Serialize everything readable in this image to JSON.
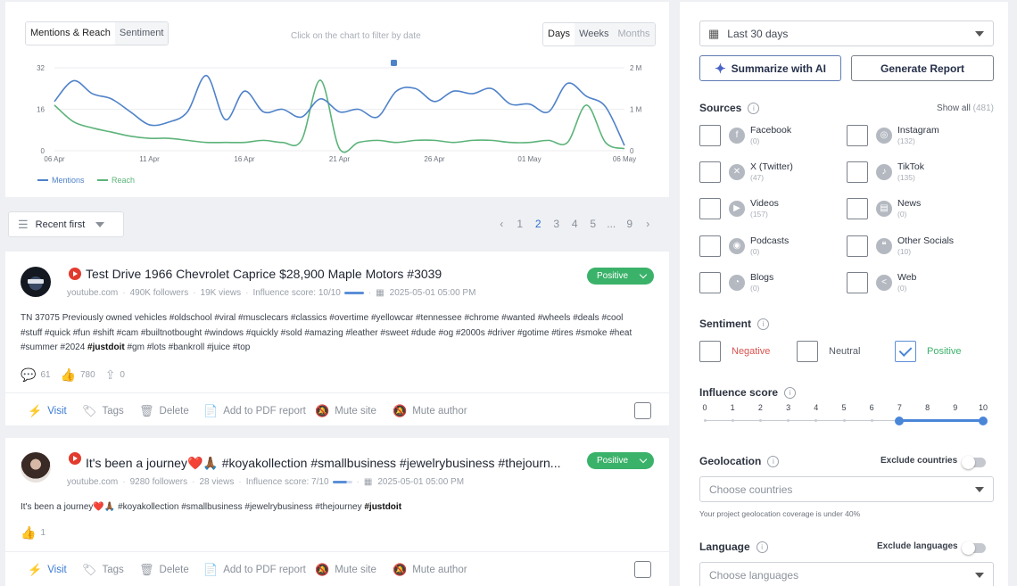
{
  "chart": {
    "tabs": [
      "Mentions & Reach",
      "Sentiment"
    ],
    "hint": "Click on the chart to filter by date",
    "range_tabs": [
      "Days",
      "Weeks",
      "Months"
    ],
    "y_left_ticks": [
      "32",
      "16",
      "0"
    ],
    "y_right_ticks": [
      "2 M",
      "1 M",
      "0"
    ],
    "x_ticks": [
      "06 Apr",
      "11 Apr",
      "16 Apr",
      "21 Apr",
      "26 Apr",
      "01 May",
      "06 May"
    ],
    "legend": [
      "Mentions",
      "Reach"
    ],
    "colors": {
      "mentions": "#4f82c9",
      "reach": "#5cb37a"
    }
  },
  "chart_data": {
    "type": "line",
    "x": [
      "06 Apr",
      "07 Apr",
      "08 Apr",
      "09 Apr",
      "10 Apr",
      "11 Apr",
      "12 Apr",
      "13 Apr",
      "14 Apr",
      "15 Apr",
      "16 Apr",
      "17 Apr",
      "18 Apr",
      "19 Apr",
      "20 Apr",
      "21 Apr",
      "22 Apr",
      "23 Apr",
      "24 Apr",
      "25 Apr",
      "26 Apr",
      "27 Apr",
      "28 Apr",
      "29 Apr",
      "30 Apr",
      "01 May",
      "02 May",
      "03 May",
      "04 May",
      "05 May",
      "06 May"
    ],
    "series": [
      {
        "name": "Mentions",
        "axis": "left",
        "values": [
          19,
          27,
          22,
          20,
          15,
          10,
          11,
          15,
          29,
          12,
          23,
          15,
          16,
          13,
          20,
          15,
          16,
          13,
          23,
          24,
          19,
          23,
          22,
          24,
          18,
          18,
          15,
          26,
          21,
          17,
          2
        ]
      },
      {
        "name": "Reach",
        "axis": "right",
        "values": [
          1.1,
          0.7,
          0.55,
          0.45,
          0.35,
          0.3,
          0.3,
          0.25,
          0.2,
          0.2,
          0.2,
          0.25,
          0.2,
          0.25,
          1.7,
          0.05,
          0.2,
          0.25,
          0.2,
          0.25,
          0.25,
          0.2,
          0.25,
          0.25,
          0.2,
          0.2,
          0.25,
          0.2,
          1.1,
          0.2,
          0.05
        ]
      }
    ],
    "ylim_left": [
      0,
      32
    ],
    "ylim_right": [
      0,
      2
    ],
    "legend_position": "bottom-left"
  },
  "sort": {
    "label": "Recent first"
  },
  "pagination": {
    "pages": [
      "1",
      "2",
      "3",
      "4",
      "5",
      "...",
      "9"
    ],
    "current": "2"
  },
  "posts": [
    {
      "title": "Test Drive 1966 Chevrolet Caprice $28,900 Maple Motors #3039",
      "source": "youtube.com",
      "followers": "490K followers",
      "views": "19K views",
      "influence": "Influence score: 10/10",
      "date": "2025-05-01 05:00 PM",
      "sentiment": "Positive",
      "text": "TN 37075 Previously owned vehicles #oldschool #viral #musclecars #classics #overtime #yellowcar #tennessee #chrome #wanted #wheels #deals #cool #stuff #quick #fun #shift #cam #builtnotbought #windows #quickly #sold #amazing #leather #sweet #dude #og #2000s #driver #gotime #tires #smoke #heat #summer #2024",
      "text_bold": "#justdoit",
      "text_after": "#gm #lots #bankroll #juice #top",
      "comments": "61",
      "likes": "780",
      "shares": "0"
    },
    {
      "title": "It's been a journey❤️🙏🏾 #koyakollection #smallbusiness #jewelrybusiness #thejourn...",
      "source": "youtube.com",
      "followers": "9280 followers",
      "views": "28 views",
      "influence": "Influence score: 7/10",
      "date": "2025-05-01 05:00 PM",
      "sentiment": "Positive",
      "text": "It's been a journey❤️🙏🏾 #koyakollection #smallbusiness #jewelrybusiness #thejourney",
      "text_bold": "#justdoit",
      "likes": "1"
    }
  ],
  "actions": [
    "Visit",
    "Tags",
    "Delete",
    "Add to PDF report",
    "Mute site",
    "Mute author"
  ],
  "filters": {
    "date_range": "Last 30 days",
    "summarize": "Summarize with AI",
    "generate": "Generate Report",
    "sources_title": "Sources",
    "show_all": "Show all",
    "show_all_count": "(481)",
    "sources": [
      {
        "name": "Facebook",
        "count": "(0)",
        "icon": "facebook-icon",
        "glyph": "f"
      },
      {
        "name": "Instagram",
        "count": "(132)",
        "icon": "instagram-icon",
        "glyph": "◎"
      },
      {
        "name": "X (Twitter)",
        "count": "(47)",
        "icon": "x-twitter-icon",
        "glyph": "✕"
      },
      {
        "name": "TikTok",
        "count": "(135)",
        "icon": "tiktok-icon",
        "glyph": "♪"
      },
      {
        "name": "Videos",
        "count": "(157)",
        "icon": "video-play-icon",
        "glyph": "▶"
      },
      {
        "name": "News",
        "count": "(0)",
        "icon": "news-icon",
        "glyph": "▤"
      },
      {
        "name": "Podcasts",
        "count": "(0)",
        "icon": "podcast-icon",
        "glyph": "◉"
      },
      {
        "name": "Other Socials",
        "count": "(10)",
        "icon": "chat-bubbles-icon",
        "glyph": "❝"
      },
      {
        "name": "Blogs",
        "count": "(0)",
        "icon": "rss-icon",
        "glyph": "◔"
      },
      {
        "name": "Web",
        "count": "(0)",
        "icon": "share-icon",
        "glyph": "<"
      }
    ],
    "sentiment_title": "Sentiment",
    "sentiment": [
      {
        "label": "Negative",
        "color": "#d9534f",
        "checked": false
      },
      {
        "label": "Neutral",
        "color": "#555b66",
        "checked": false
      },
      {
        "label": "Positive",
        "color": "#3bb26a",
        "checked": true
      }
    ],
    "influence_title": "Influence score",
    "influence_ticks": [
      "0",
      "1",
      "2",
      "3",
      "4",
      "5",
      "6",
      "7",
      "8",
      "9",
      "10"
    ],
    "influence_range": [
      7,
      10
    ],
    "geo_title": "Geolocation",
    "exclude_countries": "Exclude countries",
    "choose_countries": "Choose countries",
    "geo_note": "Your project geolocation coverage is under 40%",
    "language_title": "Language",
    "exclude_languages": "Exclude languages",
    "choose_languages": "Choose languages"
  }
}
